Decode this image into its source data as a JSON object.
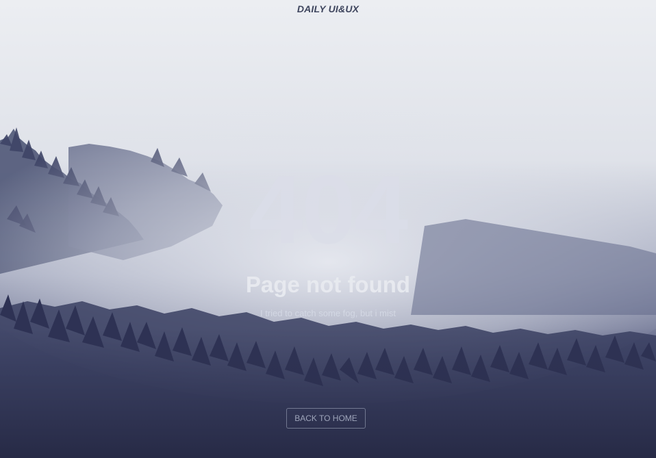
{
  "brand": {
    "text": "DAILY UI&UX"
  },
  "error": {
    "code": "404",
    "title": "Page not found",
    "message": "I tried to catch some fog, but i mist"
  },
  "actions": {
    "back_home": "BACK TO HOME"
  },
  "colors": {
    "sky": "#e6e8ed",
    "fog": "#c9cedb",
    "forest": "#2b2f4b",
    "text_light": "#e8eaf0"
  }
}
